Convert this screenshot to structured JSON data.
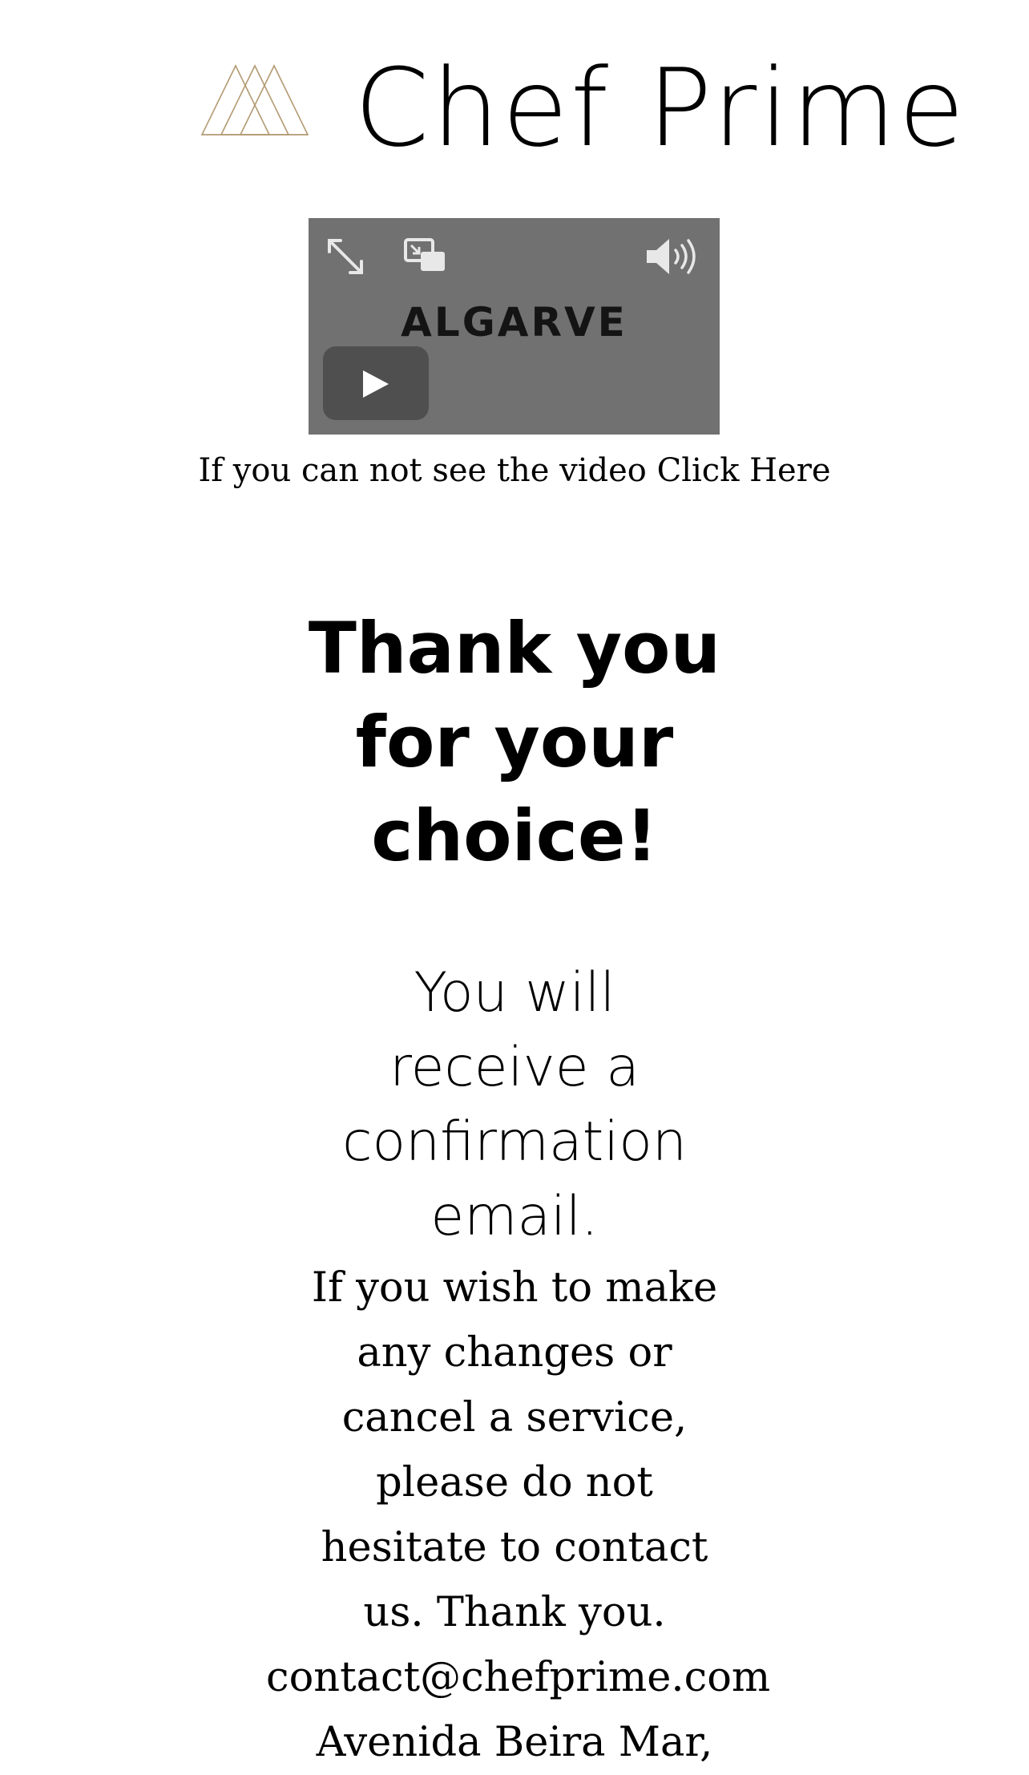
{
  "brand": {
    "name": "Chef Prime",
    "logo_color": "#b39a72"
  },
  "video": {
    "background": "#717171",
    "overlay_logo": "ALGARVE",
    "controls": [
      "expand-icon",
      "picture-in-picture-icon",
      "volume-icon",
      "play-icon"
    ]
  },
  "video_note": {
    "prefix": "If you can not see the video ",
    "link": "Click Here"
  },
  "thanks": {
    "line1": "Thank you",
    "line2": "for your",
    "line3": "choice!"
  },
  "confirmation": {
    "line1": "You will",
    "line2": "receive a",
    "line3": "confirmation",
    "line4": "email."
  },
  "info": {
    "line1": "If you wish to make",
    "line2": "any changes or",
    "line3": "cancel a service,",
    "line4": "please do not",
    "line5": "hesitate to contact",
    "line6": "us. Thank you.",
    "email": "contact@chefprime.com",
    "address_line1": "Avenida Beira Mar,"
  }
}
